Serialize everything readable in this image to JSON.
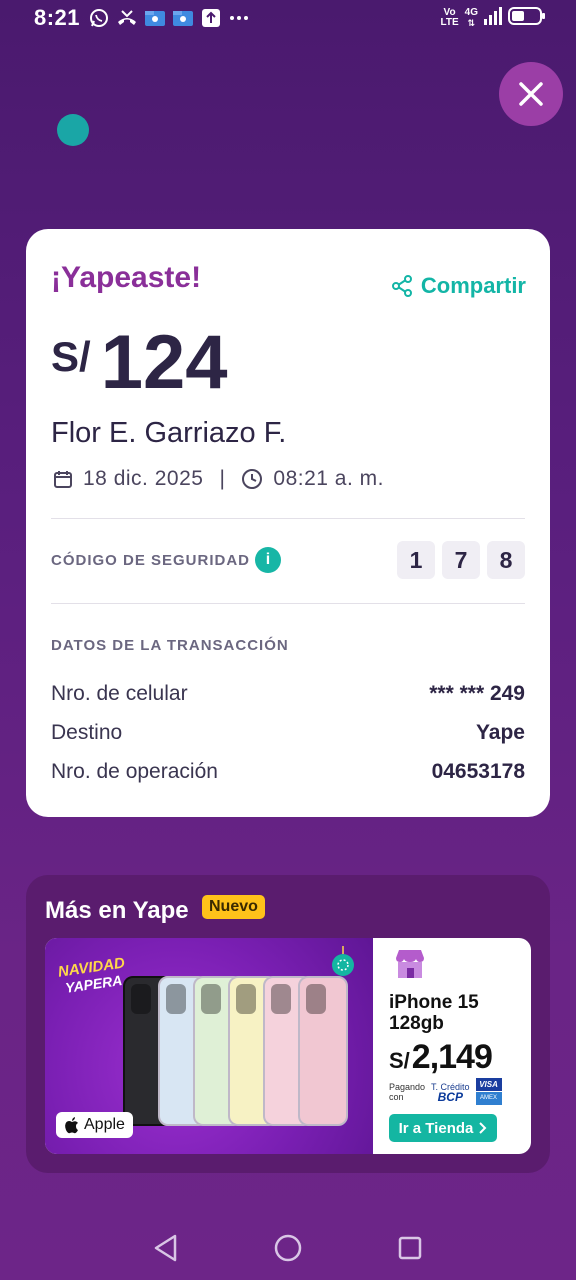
{
  "status_bar": {
    "time": "8:21",
    "network_top": "Vo",
    "network_bottom": "LTE",
    "network_type": "4G",
    "icons": [
      "whatsapp-icon",
      "missed-call-icon",
      "folder-icon",
      "folder-icon",
      "upload-icon",
      "more-icon",
      "signal-icon",
      "battery-icon"
    ]
  },
  "receipt": {
    "title": "¡Yapeaste!",
    "share_label": "Compartir",
    "currency": "S/",
    "amount": "124",
    "recipient": "Flor E. Garriazo F.",
    "date": "18 dic. 2025",
    "separator": "|",
    "time": "08:21 a. m.",
    "security_code_label": "CÓDIGO DE SEGURIDAD",
    "security_info_icon": "i",
    "security_code": [
      "1",
      "7",
      "8"
    ],
    "transaction_label": "DATOS DE LA TRANSACCIÓN",
    "rows": [
      {
        "label": "Nro. de celular",
        "value": "*** *** 249"
      },
      {
        "label": "Destino",
        "value": "Yape"
      },
      {
        "label": "Nro. de operación",
        "value": "04653178"
      }
    ]
  },
  "more": {
    "title": "Más en Yape",
    "badge": "Nuevo",
    "banner": {
      "campaign_line1": "NAVIDAD",
      "campaign_line2": "YAPERA",
      "brand": "Apple",
      "product_line1": "iPhone 15",
      "product_line2": "128gb",
      "price_currency": "S/",
      "price": "2,149",
      "paying_with_line1": "Pagando",
      "paying_with_line2": "con",
      "card_line1": "T. Crédito",
      "card_bank": "BCP",
      "card_visa": "VISA",
      "card_amex": "AMEX",
      "cta": "Ir a Tienda",
      "phone_colors": [
        "#2a2a2e",
        "#d8e6f3",
        "#dff0d6",
        "#f7f2c4",
        "#f5d2dc",
        "#f1c7d2"
      ]
    }
  },
  "colors": {
    "background": "#5a1f7e",
    "accent_purple": "#8a2f99",
    "teal": "#13b5a6"
  }
}
